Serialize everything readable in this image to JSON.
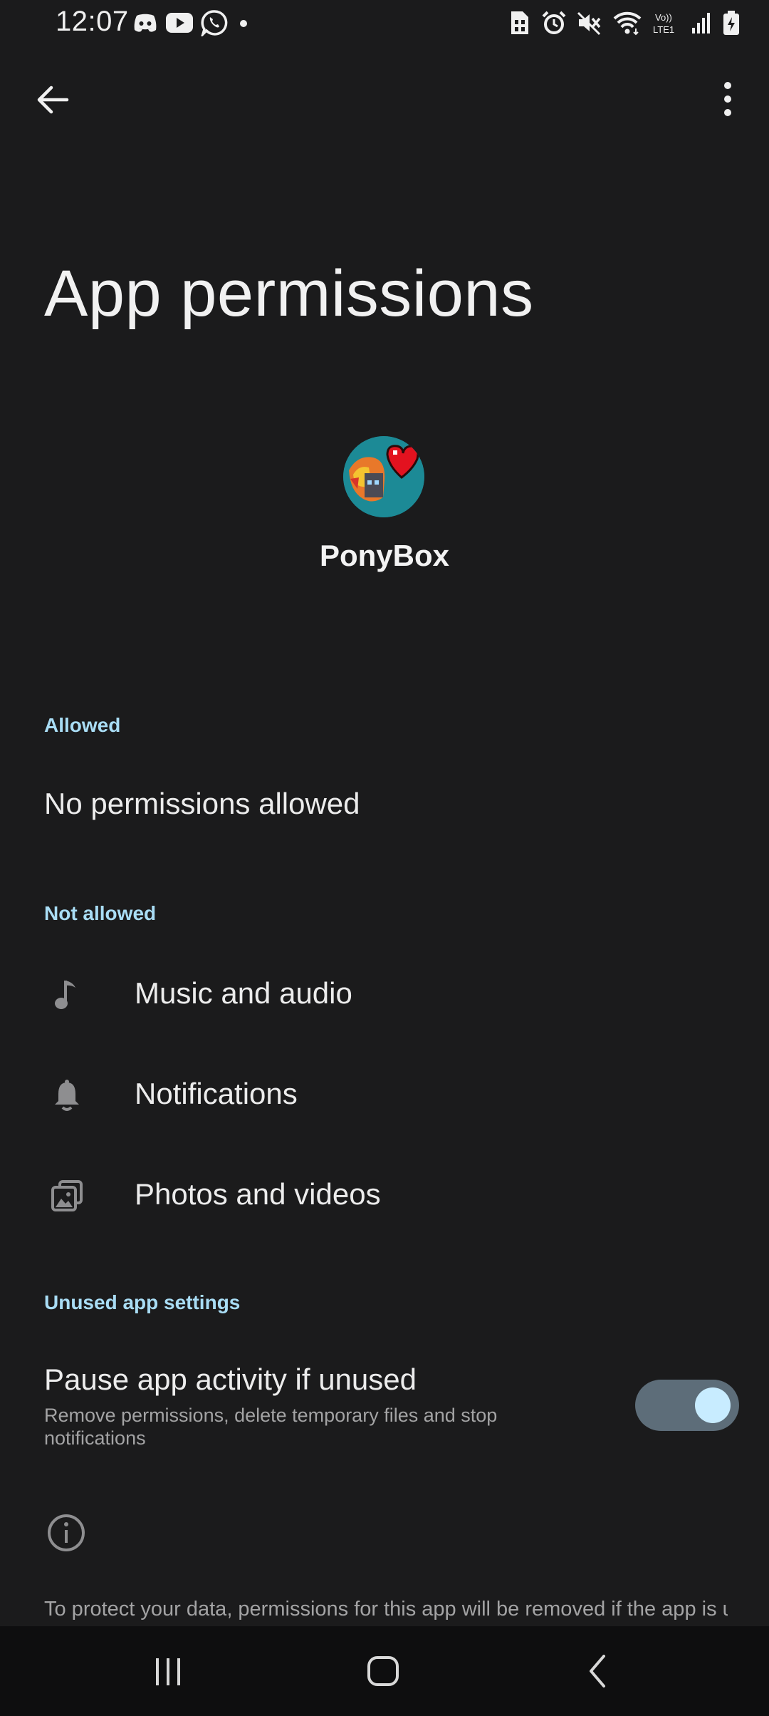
{
  "status_bar": {
    "time": "12:07",
    "left_icons": [
      "discord-icon",
      "youtube-icon",
      "whatsapp-icon",
      "dot-icon"
    ],
    "right_icons": [
      "sim-card-icon",
      "alarm-icon",
      "mute-icon",
      "wifi-icon",
      "volte-icon",
      "signal-icon",
      "battery-icon"
    ],
    "volte_label": "Vo))\nLTE1"
  },
  "top_bar": {
    "back_icon": "arrow-back-icon",
    "more_icon": "more-vert-icon"
  },
  "title": "App permissions",
  "app": {
    "name": "PonyBox",
    "icon": "app-icon"
  },
  "sections": {
    "allowed": {
      "header": "Allowed",
      "empty_text": "No permissions allowed"
    },
    "not_allowed": {
      "header": "Not allowed",
      "items": [
        {
          "label": "Music and audio",
          "icon": "music-note-icon"
        },
        {
          "label": "Notifications",
          "icon": "bell-icon"
        },
        {
          "label": "Photos and videos",
          "icon": "photos-icon"
        }
      ]
    },
    "unused": {
      "header": "Unused app settings",
      "setting_title": "Pause app activity if unused",
      "setting_desc": "Remove permissions, delete temporary files and stop notifications",
      "toggle_on": true
    }
  },
  "footer_text": "To protect your data, permissions for this app will be removed if the app is unused for a few months.",
  "nav_bar": {
    "recent_icon": "recents-icon",
    "home_icon": "home-icon",
    "back_icon": "nav-back-icon"
  },
  "colors": {
    "background": "#1b1b1c",
    "accent": "#a9ddf5",
    "toggle_track": "#5d6d79",
    "toggle_knob": "#c8ecff"
  }
}
